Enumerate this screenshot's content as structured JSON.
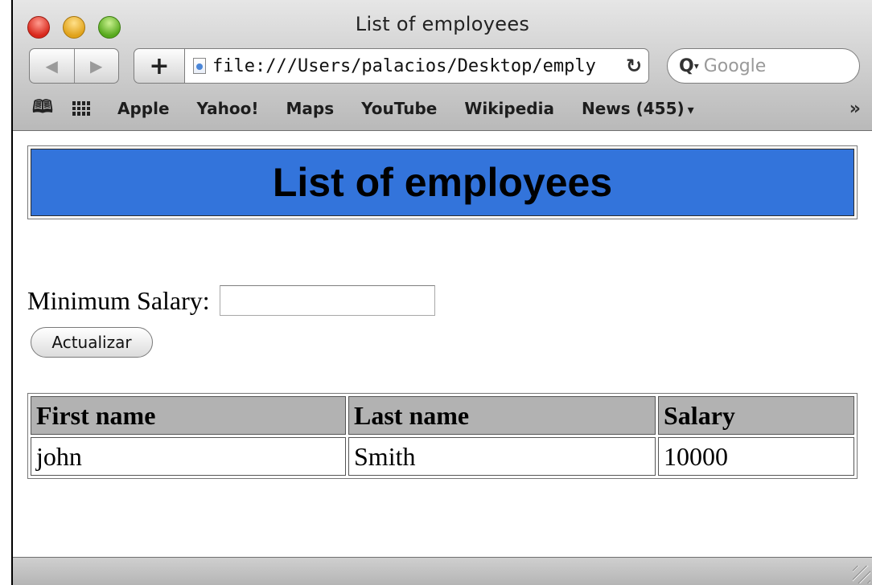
{
  "window": {
    "title": "List of employees"
  },
  "toolbar": {
    "back_icon": "◀",
    "forward_icon": "▶",
    "add_icon": "+",
    "url": "file:///Users/palacios/Desktop/emply",
    "reload_icon": "↻",
    "search_placeholder": "Google"
  },
  "bookmarks": {
    "items": [
      "Apple",
      "Yahoo!",
      "Maps",
      "YouTube",
      "Wikipedia",
      "News (455)"
    ],
    "news_menu_icon": "▾",
    "more_icon": "»"
  },
  "page": {
    "heading": "List of employees",
    "min_salary_label": "Minimum Salary:",
    "min_salary_value": "",
    "update_button": "Actualizar",
    "table": {
      "headers": [
        "First name",
        "Last name",
        "Salary"
      ],
      "rows": [
        [
          "john",
          "Smith",
          "10000"
        ]
      ]
    }
  },
  "colors": {
    "heading_bg": "#3374db",
    "table_header_bg": "#b2b2b2"
  }
}
